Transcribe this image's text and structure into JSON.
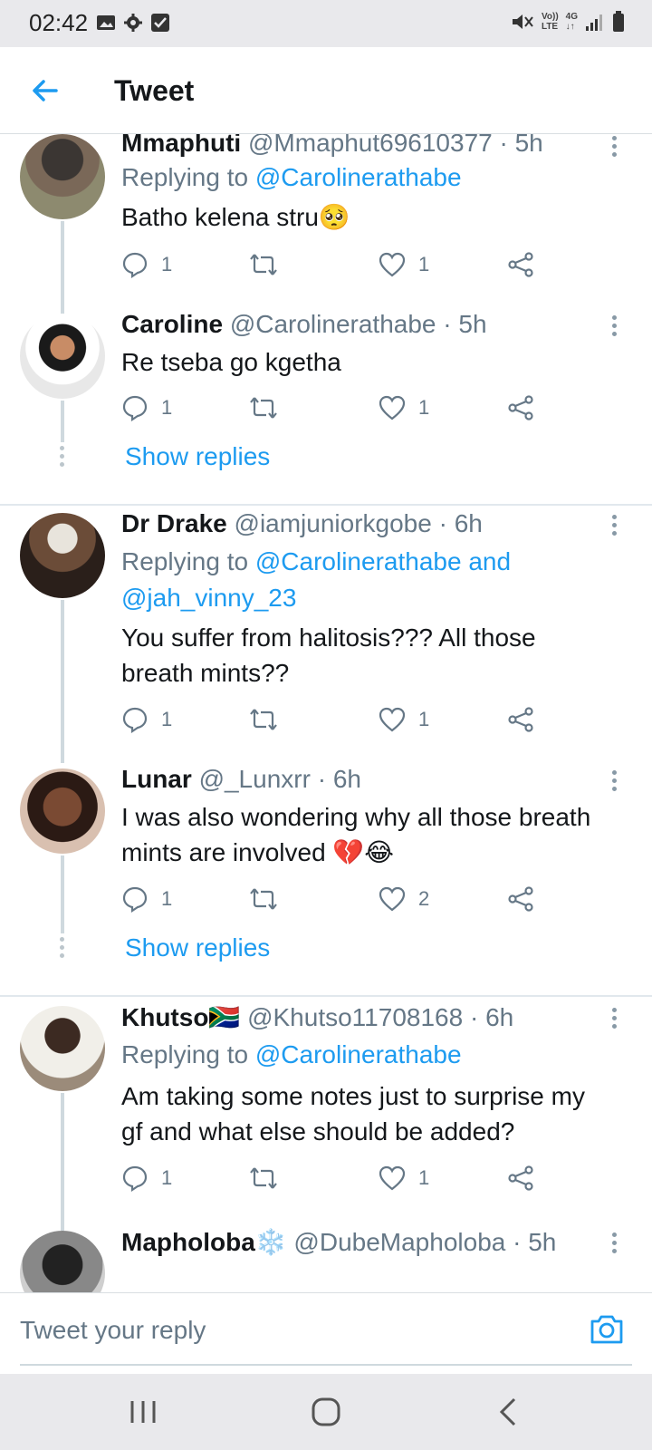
{
  "status_bar": {
    "time": "02:42",
    "volte": "Vo))",
    "lte": "LTE",
    "network": "4G"
  },
  "header": {
    "title": "Tweet",
    "back_icon": "arrow-left-icon"
  },
  "tweets": [
    {
      "name": "Mmaphuti",
      "handle": "@Mmaphut69610377",
      "time": "· 5h",
      "replying_prefix": "Replying to ",
      "replying_to": "@Carolinerathabe",
      "text": "Batho kelena stru🥺",
      "replies": "1",
      "retweets": "",
      "likes": "1"
    },
    {
      "name": "Caroline",
      "handle": "@Carolinerathabe",
      "time": "· 5h",
      "text": "Re tseba go kgetha",
      "replies": "1",
      "retweets": "",
      "likes": "1",
      "show_replies": "Show replies"
    },
    {
      "name": "Dr Drake",
      "handle": "@iamjuniorkgobe",
      "time": "· 6h",
      "replying_prefix": "Replying to ",
      "replying_to": "@Carolinerathabe and",
      "replying_to_2": "@jah_vinny_23",
      "text_line1": "You suffer from halitosis??? All those",
      "text_line2": "breath mints??",
      "replies": "1",
      "retweets": "",
      "likes": "1"
    },
    {
      "name": "Lunar",
      "handle": "@_Lunxrr",
      "time": "· 6h",
      "text_line1": "I was also wondering why all those breath",
      "text_line2": "mints are involved 💔😂",
      "replies": "1",
      "retweets": "",
      "likes": "2",
      "show_replies": "Show replies"
    },
    {
      "name": "Khutso🇿🇦",
      "handle": "@Khutso11708168",
      "time": "· 6h",
      "replying_prefix": "Replying to ",
      "replying_to": "@Carolinerathabe",
      "text_line1": "Am taking some notes just to surprise my",
      "text_line2": "gf and what else should be added?",
      "replies": "1",
      "retweets": "",
      "likes": "1"
    },
    {
      "name": "Mapholoba❄️",
      "handle": "@DubeMapholoba",
      "time": "· 5h"
    }
  ],
  "composer": {
    "placeholder": "Tweet your reply",
    "camera_icon": "camera-icon"
  },
  "colors": {
    "accent": "#1d9bf0",
    "secondary_text": "#657786",
    "primary_text": "#14171a"
  }
}
